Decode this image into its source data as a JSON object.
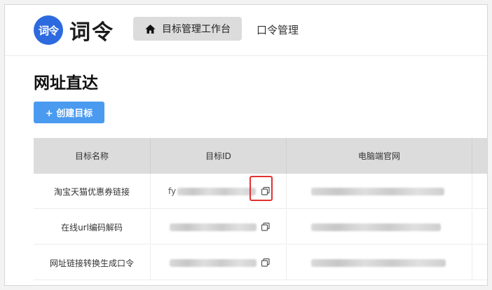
{
  "app": {
    "logo_badge": "词令",
    "logo_text": "词令"
  },
  "nav": {
    "active_label": "目标管理工作台",
    "active_icon": "home-icon",
    "second_label": "口令管理"
  },
  "page": {
    "title": "网址直达",
    "create_button": "+ 创建目标"
  },
  "table": {
    "headers": [
      "目标名称",
      "目标ID",
      "电脑端官网"
    ],
    "rows": [
      {
        "name": "淘宝天猫优惠券链接",
        "id_prefix": "fy"
      },
      {
        "name": "在线url编码解码",
        "id_prefix": ""
      },
      {
        "name": "网址链接转换生成口令",
        "id_prefix": ""
      }
    ]
  },
  "colors": {
    "accent": "#4a9bf0",
    "logo": "#2d6ae0",
    "highlight": "#e23131"
  }
}
